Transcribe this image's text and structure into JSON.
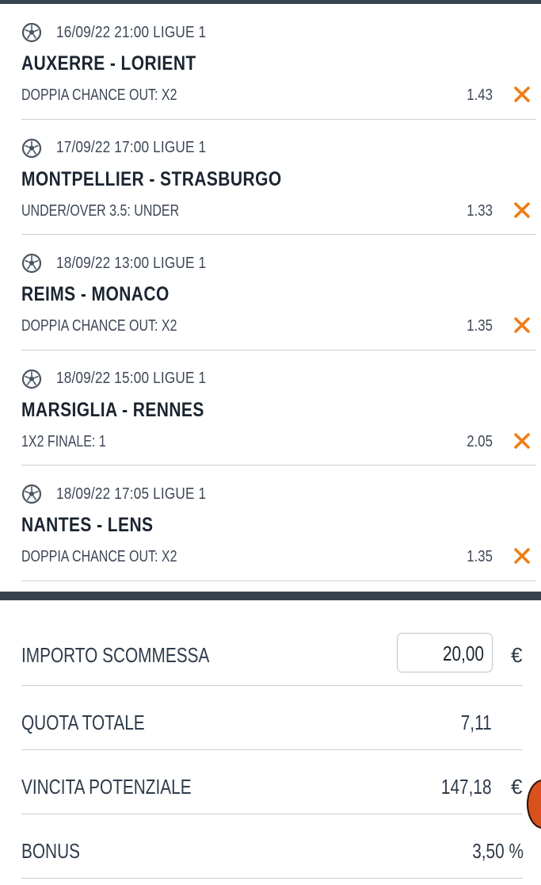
{
  "bets": [
    {
      "meta": "16/09/22 21:00 LIGUE 1",
      "match": "AUXERRE - LORIENT",
      "market": "DOPPIA CHANCE OUT: X2",
      "odd": "1.43"
    },
    {
      "meta": "17/09/22 17:00 LIGUE 1",
      "match": "MONTPELLIER - STRASBURGO",
      "market": "UNDER/OVER 3.5: UNDER",
      "odd": "1.33"
    },
    {
      "meta": "18/09/22 13:00 LIGUE 1",
      "match": "REIMS - MONACO",
      "market": "DOPPIA CHANCE OUT: X2",
      "odd": "1.35"
    },
    {
      "meta": "18/09/22 15:00 LIGUE 1",
      "match": "MARSIGLIA - RENNES",
      "market": "1X2 FINALE: 1",
      "odd": "2.05"
    },
    {
      "meta": "18/09/22 17:05 LIGUE 1",
      "match": "NANTES - LENS",
      "market": "DOPPIA CHANCE OUT: X2",
      "odd": "1.35"
    }
  ],
  "summary": {
    "stake_label": "IMPORTO SCOMMESSA",
    "stake_value": "20,00",
    "currency": "€",
    "total_odds_label": "QUOTA TOTALE",
    "total_odds_value": "7,11",
    "potential_win_label": "VINCITA POTENZIALE",
    "potential_win_value": "147,18",
    "bonus_label": "BONUS",
    "bonus_value": "3,50 %"
  },
  "icons": {
    "sport": "soccer-ball-icon",
    "remove": "close-icon"
  },
  "colors": {
    "remove": "#f07d16",
    "dark_bar": "#39434f",
    "text": "#2f3b4a"
  }
}
